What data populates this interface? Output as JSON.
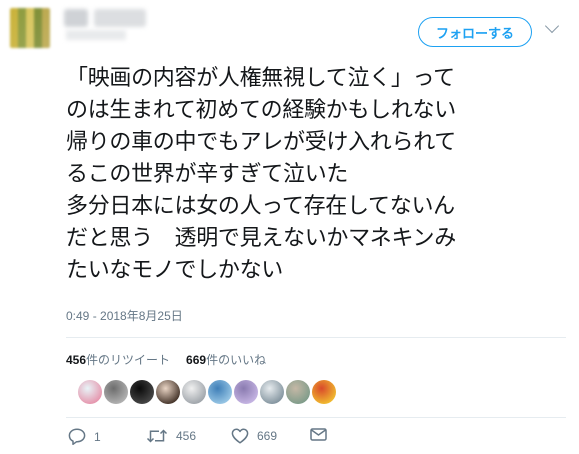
{
  "header": {
    "follow_label": "フォローする"
  },
  "tweet": {
    "lines": [
      "「映画の内容が人権無視して泣く」って",
      "のは生まれて初めての経験かもしれない",
      "帰りの車の中でもアレが受け入れられて",
      "るこの世界が辛すぎて泣いた",
      "多分日本には女の人って存在してないん",
      "だと思う　透明で見えないかマネキンみ",
      "たいなモノでしかない"
    ],
    "timestamp": "0:49 - 2018年8月25日"
  },
  "stats": {
    "retweet_count": "456",
    "retweet_label": "件のリツイート",
    "like_count": "669",
    "like_label": "件のいいね"
  },
  "likers": [
    {
      "icon": "liker-avatar",
      "colors": [
        "#e8f4f8",
        "#e58fa8"
      ]
    },
    {
      "icon": "liker-avatar",
      "colors": [
        "#6d6d6d",
        "#b6b6b6"
      ]
    },
    {
      "icon": "liker-avatar",
      "colors": [
        "#0a0a0a",
        "#4a4a4a"
      ]
    },
    {
      "icon": "liker-avatar",
      "colors": [
        "#e9d4c4",
        "#3a2a20"
      ]
    },
    {
      "icon": "liker-avatar",
      "colors": [
        "#f0f0f0",
        "#9aa0a6"
      ]
    },
    {
      "icon": "liker-avatar",
      "colors": [
        "#3f7fb8",
        "#9ecbe8"
      ]
    },
    {
      "icon": "liker-avatar",
      "colors": [
        "#8a7bb0",
        "#c9b8e6"
      ]
    },
    {
      "icon": "liker-avatar",
      "colors": [
        "#e6ebee",
        "#7d8f9a"
      ]
    },
    {
      "icon": "liker-avatar",
      "colors": [
        "#c5b8a6",
        "#7a9a88"
      ]
    },
    {
      "icon": "liker-avatar",
      "colors": [
        "#d94a2b",
        "#f2c230"
      ]
    }
  ],
  "actions": {
    "reply_count": "1",
    "retweet_count": "456",
    "like_count": "669"
  },
  "colors": {
    "accent": "#1da1f2",
    "muted": "#657786",
    "text": "#14171a"
  }
}
